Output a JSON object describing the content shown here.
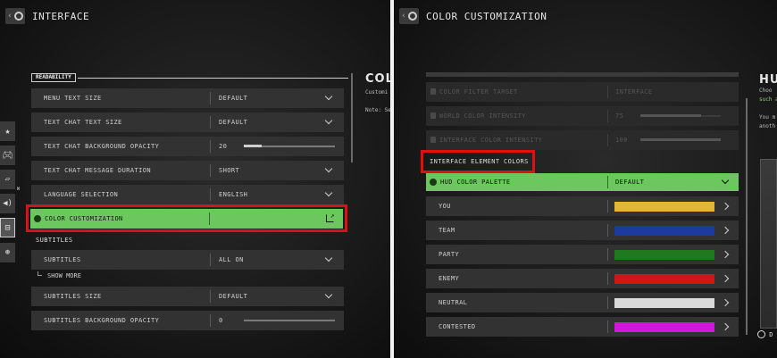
{
  "left": {
    "title": "INTERFACE",
    "section_readability": "READABILITY",
    "rows": [
      {
        "label": "MENU TEXT SIZE",
        "value": "DEFAULT"
      },
      {
        "label": "TEXT CHAT TEXT SIZE",
        "value": "DEFAULT"
      },
      {
        "label": "TEXT CHAT BACKGROUND OPACITY",
        "value": "20",
        "slider": 0.18
      },
      {
        "label": "TEXT CHAT MESSAGE DURATION",
        "value": "SHORT"
      },
      {
        "label": "LANGUAGE SELECTION",
        "value": "ENGLISH"
      },
      {
        "label": "COLOR CUSTOMIZATION",
        "value": ""
      }
    ],
    "section_subtitles": "SUBTITLES",
    "subrows": [
      {
        "label": "SUBTITLES",
        "value": "ALL ON"
      },
      {
        "label": "SHOW MORE"
      },
      {
        "label": "SUBTITLES SIZE",
        "value": "DEFAULT"
      },
      {
        "label": "SUBTITLES BACKGROUND OPACITY",
        "value": "0",
        "slider": 0
      }
    ],
    "side_title": "COLO",
    "side_desc": [
      "Customi",
      "",
      "Note: Se"
    ],
    "side_badge": "W"
  },
  "right": {
    "title": "COLOR CUSTOMIZATION",
    "dim_rows": [
      {
        "label": "COLOR FILTER TARGET",
        "value": "INTERFACE"
      },
      {
        "label": "WORLD COLOR INTENSITY",
        "value": "75",
        "slider": 0.75
      },
      {
        "label": "INTERFACE COLOR INTENSITY",
        "value": "100",
        "slider": 1.0
      }
    ],
    "section": "INTERFACE ELEMENT COLORS",
    "palette": {
      "label": "HUD COLOR PALETTE",
      "value": "DEFAULT"
    },
    "colors": [
      {
        "label": "YOU",
        "color": "#e5b534"
      },
      {
        "label": "TEAM",
        "color": "#1d3a9e"
      },
      {
        "label": "PARTY",
        "color": "#1f7a1f"
      },
      {
        "label": "ENEMY",
        "color": "#d11616"
      },
      {
        "label": "NEUTRAL",
        "color": "#d9d9d9"
      },
      {
        "label": "CONTESTED",
        "color": "#d616d6"
      }
    ],
    "side_title": "HUI",
    "side_desc": [
      "Choo",
      "such a",
      "",
      "You m",
      "anoth"
    ],
    "footer_hint": "D"
  }
}
